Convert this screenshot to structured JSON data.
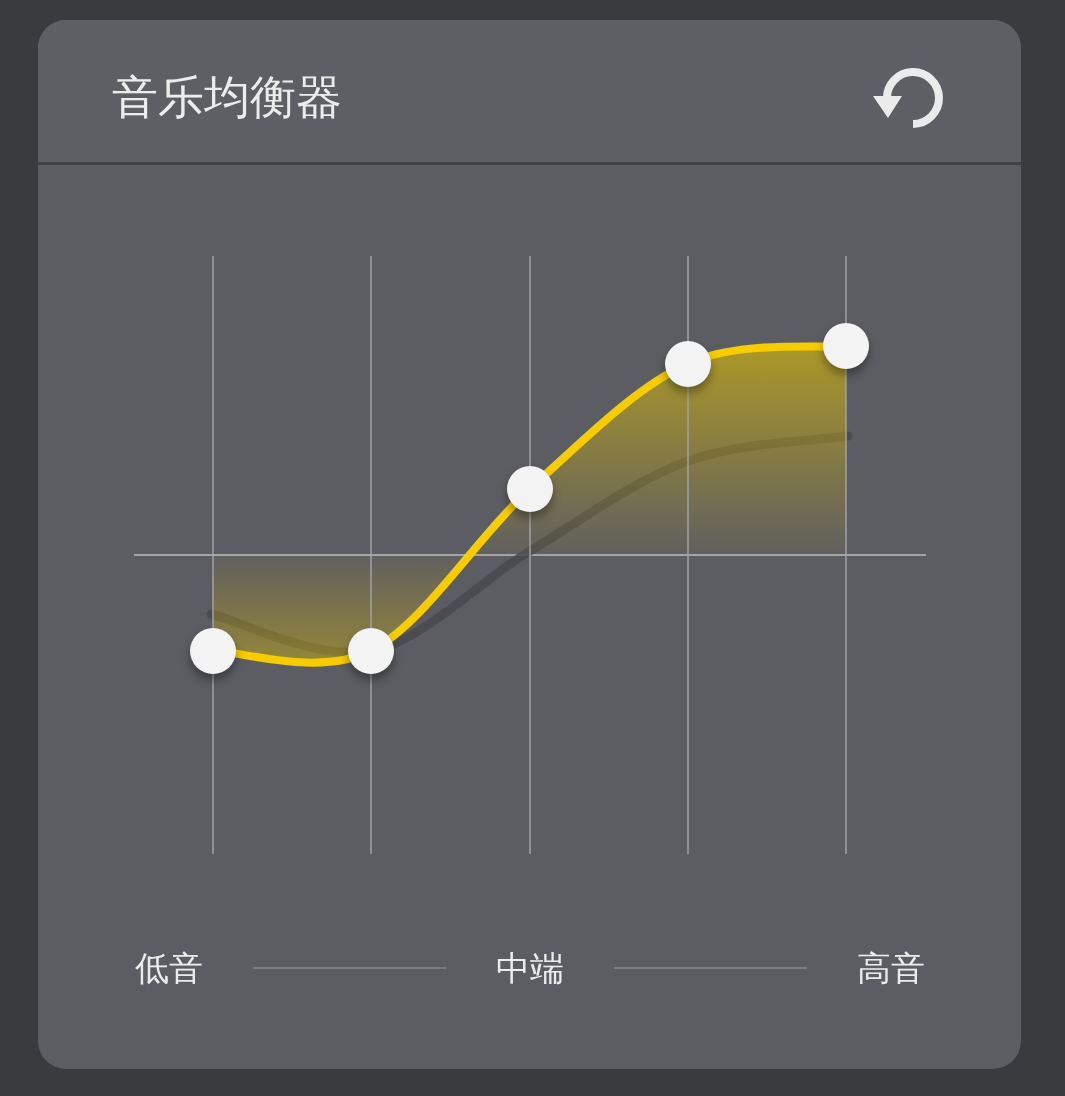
{
  "header": {
    "title": "音乐均衡器"
  },
  "equalizer": {
    "bands": [
      {
        "level": 0.34
      },
      {
        "level": 0.34
      },
      {
        "level": 0.61
      },
      {
        "level": 0.82
      },
      {
        "level": 0.85
      }
    ]
  },
  "range_labels": [
    "低音",
    "中端",
    "高音"
  ]
}
